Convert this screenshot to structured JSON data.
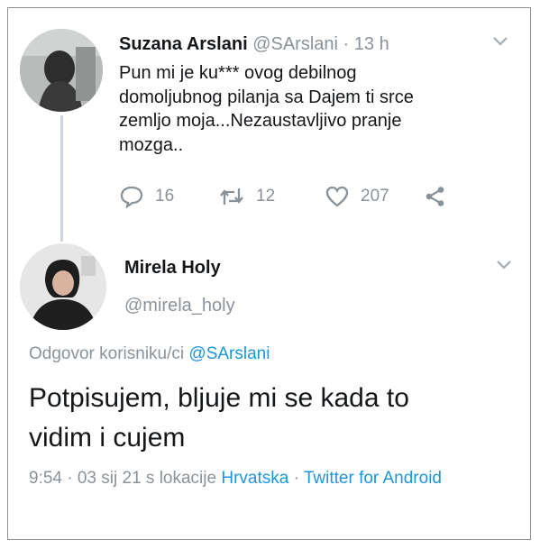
{
  "colors": {
    "link": "#1b95e0",
    "muted": "#8a9299",
    "text": "#14171a",
    "thread_line": "#cfd5da"
  },
  "tweet1": {
    "name": "Suzana Arslani",
    "handle": "@SArslani",
    "separator": "·",
    "time": "13 h",
    "text": "Pun mi je ku*** ovog debilnog\ndomoljubnog pilanja sa Dajem ti srce\nzemljo moja...Nezaustavljivo pranje\nmozga..",
    "reply_count": "16",
    "retweet_count": "12",
    "like_count": "207",
    "icons": [
      "reply-icon",
      "retweet-icon",
      "heart-icon",
      "share-icon",
      "chevron-down-icon"
    ]
  },
  "tweet2": {
    "name": "Mirela Holy",
    "handle": "@mirela_holy",
    "reply_prefix": "Odgovor korisniku/ci",
    "reply_handle": "@SArslani",
    "text": "Potpisujem, bljuje mi se kada to\nvidim i cujem",
    "meta_time": "9:54 · 03 sij 21 s lokacije",
    "meta_location": "Hrvatska",
    "meta_sep": " · ",
    "meta_client": "Twitter for Android"
  }
}
